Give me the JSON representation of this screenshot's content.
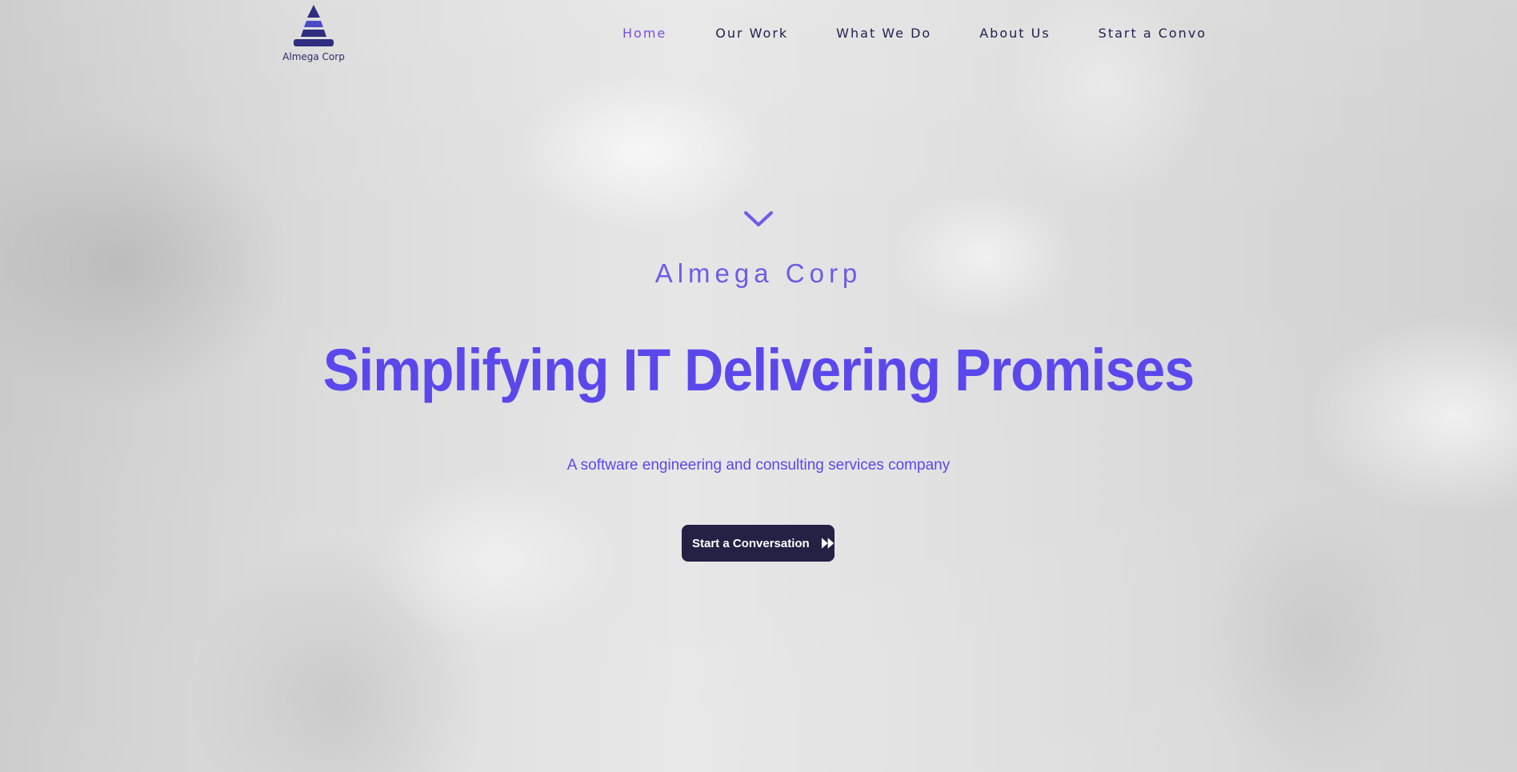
{
  "header": {
    "logo_text": "Almega Corp",
    "nav": [
      {
        "label": "Home",
        "active": true
      },
      {
        "label": "Our Work"
      },
      {
        "label": "What We Do"
      },
      {
        "label": "About Us"
      },
      {
        "label": "Start a Convo"
      }
    ]
  },
  "hero": {
    "scroll_icon": "chevron-down-icon",
    "brand": "Almega Corp",
    "headline": "Simplifying IT Delivering Promises",
    "subtitle": "A software engineering and consulting services company",
    "cta_label": "Start a Conversation",
    "cta_icon": "double-play-icon"
  },
  "colors": {
    "accent": "#5b48ec",
    "nav_active": "#7a4fe0",
    "nav_text": "#24214f",
    "cta_background": "#242145",
    "logo": "#2e2d80"
  }
}
